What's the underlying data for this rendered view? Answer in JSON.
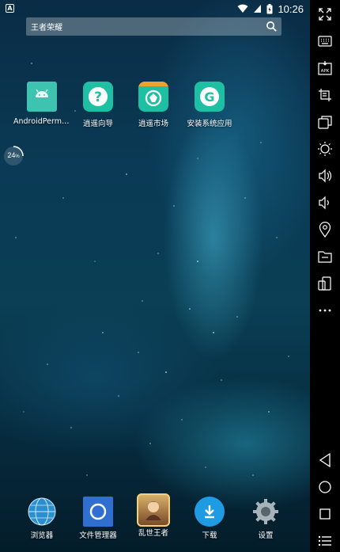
{
  "status_bar": {
    "time": "10:26",
    "notification_glyph": "A"
  },
  "search": {
    "placeholder": "王者荣耀"
  },
  "widget": {
    "value": "24",
    "unit": "%"
  },
  "apps": [
    {
      "label": "AndroidPermiss..."
    },
    {
      "label": "逍遥向导"
    },
    {
      "label": "逍遥市场"
    },
    {
      "label": "安装系统应用"
    }
  ],
  "dock": [
    {
      "label": "浏览器"
    },
    {
      "label": "文件管理器"
    },
    {
      "label": "乱世王者"
    },
    {
      "label": "下载"
    },
    {
      "label": "设置"
    }
  ],
  "colors": {
    "teal_accent": "#1fbfa3",
    "download_blue": "#1e9be3",
    "sidebar_bg": "#000000"
  }
}
